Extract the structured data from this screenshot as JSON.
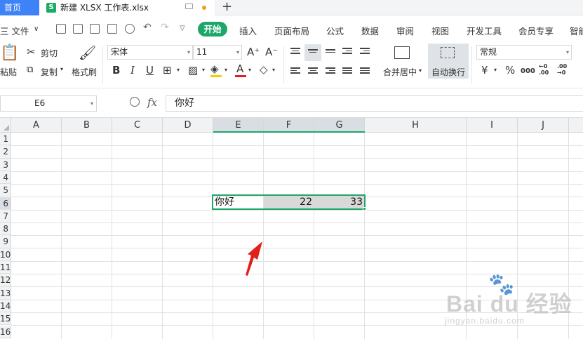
{
  "tabs": {
    "home_label": "首页",
    "file_label": "新建 XLSX 工作表.xlsx",
    "file_icon_letter": "S",
    "add_label": "+"
  },
  "menu": {
    "file_label": "三 文件",
    "file_arrow": "∨",
    "items": [
      "开始",
      "插入",
      "页面布局",
      "公式",
      "数据",
      "审阅",
      "视图",
      "开发工具",
      "会员专享",
      "智能"
    ]
  },
  "ribbon": {
    "paste_label": "粘贴",
    "cut_label": "剪切",
    "copy_label": "复制",
    "format_painter_label": "格式刷",
    "font_name": "宋体",
    "font_size": "11",
    "grow_label": "A⁺",
    "shrink_label": "A⁻",
    "bold": "B",
    "italic": "I",
    "underline": "U",
    "font_color": "A",
    "merge_label": "合并居中",
    "wrap_label": "自动换行",
    "number_format": "常规",
    "currency": "¥",
    "percent": "%",
    "thousands": "000",
    "inc_decimal": "←0 .00",
    "dec_decimal": ".00 →0"
  },
  "formula_bar": {
    "cell_ref": "E6",
    "fx": "fx",
    "content": "你好"
  },
  "grid": {
    "columns": [
      "A",
      "B",
      "C",
      "D",
      "E",
      "F",
      "G",
      "H",
      "I",
      "J"
    ],
    "rows": [
      "1",
      "2",
      "3",
      "4",
      "5",
      "6",
      "7",
      "8",
      "9",
      "10",
      "11",
      "12",
      "13",
      "14",
      "15",
      "16"
    ],
    "selected_columns": [
      "E",
      "F",
      "G"
    ],
    "selected_row": "6",
    "cells": {
      "E6": "你好",
      "F6": "22",
      "G6": "33"
    }
  },
  "watermark": {
    "main": "Bai du 经验",
    "sub": "jingyan.baidu.com"
  },
  "colors": {
    "accent_green": "#1ea66a",
    "home_tab_blue": "#3d82f6",
    "arrow_red": "#e0201a"
  }
}
